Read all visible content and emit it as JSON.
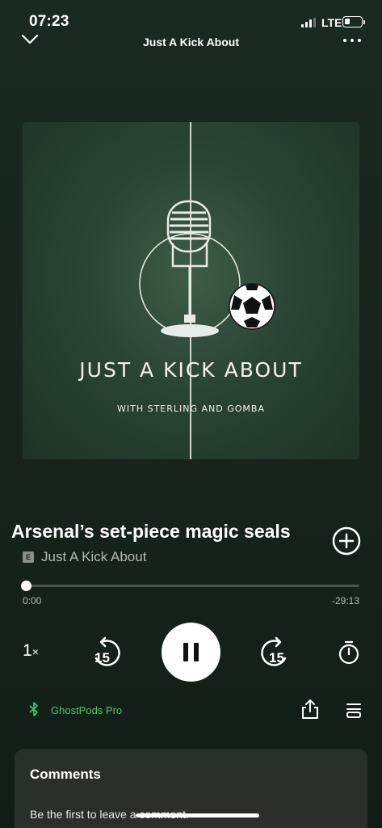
{
  "status_bar": {
    "time": "07:23",
    "network": "LTE",
    "battery_level": 0.25
  },
  "header": {
    "title": "Just A Kick About",
    "collapse_icon": "chevron-down-icon",
    "more_icon": "more-horizontal-icon"
  },
  "artwork": {
    "title": "JUST A KICK ABOUT",
    "subtitle": "WITH STERLING AND GOMBA"
  },
  "episode": {
    "title": "Arsenal’s set-piece magic seals",
    "explicit_badge": "E",
    "show_name": "Just A Kick About"
  },
  "progress": {
    "elapsed": "0:00",
    "remaining": "-29:13",
    "fraction": 0.0
  },
  "controls": {
    "speed_value": "1",
    "speed_suffix": "×",
    "skip_back_seconds": "15",
    "skip_forward_seconds": "15",
    "state": "playing"
  },
  "device": {
    "name": "GhostPods Pro",
    "icon": "bluetooth-icon",
    "color": "#3ecf6a"
  },
  "comments": {
    "title": "Comments",
    "empty_text": "Be the first to leave a comment."
  }
}
